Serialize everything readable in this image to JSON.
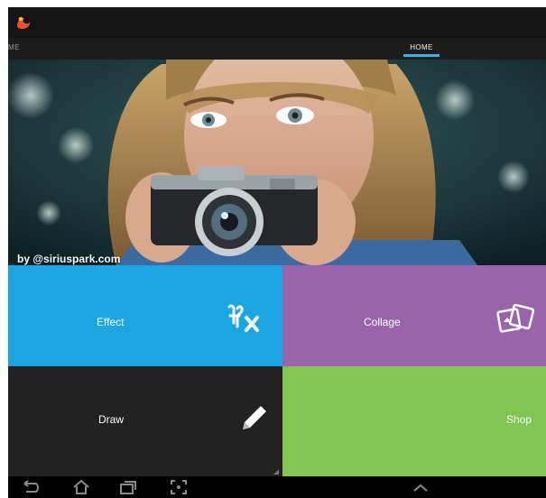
{
  "tabs": {
    "left": "ME",
    "home": "HOME"
  },
  "hero": {
    "credit": "by @siriuspark.com"
  },
  "tiles": [
    {
      "label": "Effect",
      "icon": "fx-icon"
    },
    {
      "label": "Collage",
      "icon": "collage-icon"
    },
    {
      "label": "Draw",
      "icon": "pencil-icon"
    },
    {
      "label": "Shop",
      "icon": ""
    }
  ],
  "navbar": {
    "icons": [
      "back-icon",
      "home-icon",
      "recent-apps-icon",
      "screenshot-icon",
      "chevron-up-icon"
    ]
  },
  "colors": {
    "accent": "#33b5e5",
    "effect": "#1ba6e3",
    "collage": "#9a64ad",
    "draw": "#222222",
    "shop": "#80c551"
  }
}
